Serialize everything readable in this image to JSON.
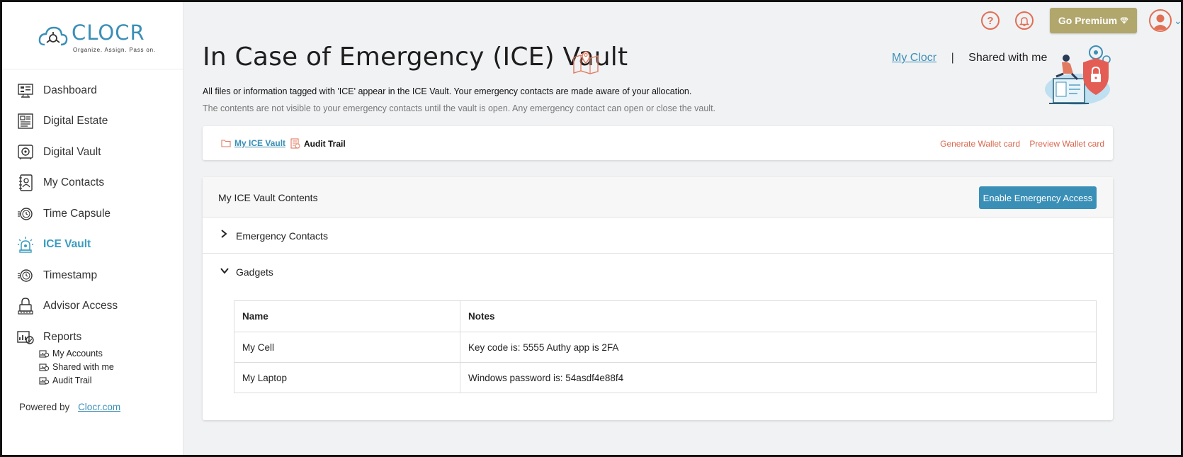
{
  "brand": {
    "name": "CLOCR",
    "tagline": "Organize. Assign. Pass on."
  },
  "sidebar": {
    "items": [
      {
        "label": "Dashboard",
        "icon": "dashboard-icon"
      },
      {
        "label": "Digital Estate",
        "icon": "digital-estate-icon"
      },
      {
        "label": "Digital Vault",
        "icon": "vault-icon"
      },
      {
        "label": "My Contacts",
        "icon": "contacts-icon"
      },
      {
        "label": "Time Capsule",
        "icon": "time-capsule-icon"
      },
      {
        "label": "ICE Vault",
        "icon": "ice-siren-icon",
        "active": true
      },
      {
        "label": "Timestamp",
        "icon": "timestamp-icon"
      },
      {
        "label": "Advisor Access",
        "icon": "advisor-lock-icon"
      },
      {
        "label": "Reports",
        "icon": "reports-icon"
      }
    ],
    "report_subitems": [
      {
        "label": "My Accounts"
      },
      {
        "label": "Shared with me"
      },
      {
        "label": "Audit Trail"
      }
    ],
    "powered_by": "Powered by",
    "powered_link": "Clocr.com"
  },
  "topbar": {
    "help_symbol": "?",
    "premium_label": "Go Premium",
    "premium_icon": "diamond-icon",
    "avatar_chevron": "⌄"
  },
  "header": {
    "title": "In Case of Emergency (ICE) Vault",
    "description": "All files or information tagged with 'ICE' appear in the ICE Vault. Your emergency contacts are made aware of your allocation.",
    "note": "The contents are not visible to your emergency contacts until the vault is open. Any emergency contact can open or close the vault.",
    "link_my": "My Clocr",
    "separator": "|",
    "link_shared": "Shared with me"
  },
  "tabs": {
    "vault_label": "My ICE Vault",
    "audit_label": "Audit Trail",
    "generate_wallet": "Generate Wallet card",
    "preview_wallet": "Preview Wallet card"
  },
  "panel": {
    "title": "My ICE Vault Contents",
    "enable_button": "Enable Emergency Access",
    "sections": [
      {
        "label": "Emergency Contacts",
        "expanded": false
      },
      {
        "label": "Gadgets",
        "expanded": true
      }
    ],
    "table": {
      "headers": [
        "Name",
        "Notes"
      ],
      "rows": [
        [
          "My Cell",
          "Key code is: 5555 Authy app is 2FA"
        ],
        [
          "My Laptop",
          "Windows password is: 54asdf4e88f4"
        ]
      ]
    }
  },
  "colors": {
    "accent": "#3a8fb7",
    "premium": "#b1a76d",
    "alert": "#e06f54"
  }
}
